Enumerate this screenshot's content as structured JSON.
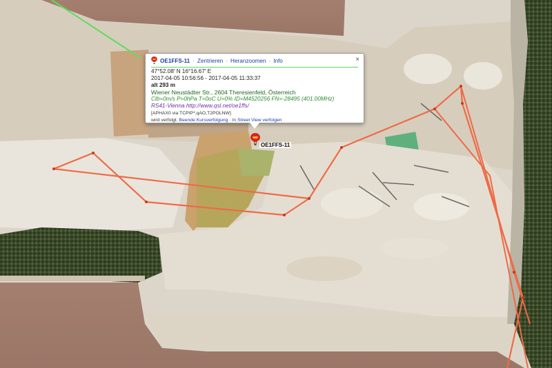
{
  "station": {
    "callsign": "OE1FFS-11",
    "marker_label": "OE1FFS-11",
    "marker_icon": "balloon-icon"
  },
  "popup": {
    "actions": [
      "Zentrieren",
      "Heranzoomen",
      "Info"
    ],
    "separator": "·",
    "close_symbol": "×",
    "coords": "47°52.08' N 16°16.67' E",
    "time_first": "2017-04-05 10:56:56",
    "time_sep": " - ",
    "time_last": "2017-04-05 11:33:37",
    "altitude": "alt 293 m",
    "address": "Wiener Neustädter Str., 2604 Theresienfeld, Österreich",
    "telemetry": "Clb=0m/s P=0hPa T=0oC U=0% ID=M4520256 FN=-28495 (401.00MHz)",
    "comment_prefix": "RS41-Vienna",
    "comment_url": "http://www.qsl.net/oe1ffs/",
    "path": "[APHAX0 via TCPIP*,qAO,T2POLNW]",
    "footer_prefix": "wird verfolgt.",
    "footer_links": [
      "Beende Kursverfolgung",
      "In Street View verfolgen"
    ]
  },
  "colors": {
    "track": "#ee6a46",
    "popup_rule": "#5cd65c",
    "link": "#1b3fa6"
  }
}
